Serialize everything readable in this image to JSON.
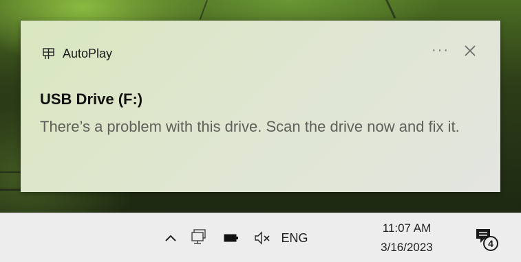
{
  "toast": {
    "app_name": "AutoPlay",
    "more_label": "···",
    "title": "USB Drive (F:)",
    "body": "There’s a problem with this drive.  Scan the drive now and fix it."
  },
  "taskbar": {
    "language": "ENG",
    "time": "11:07 AM",
    "date": "3/16/2023",
    "notification_count": "4"
  },
  "icons": {
    "app": "autoplay-icon",
    "close": "close-icon",
    "chevron": "chevron-up-icon",
    "network": "network-icon",
    "battery": "battery-icon",
    "volume": "volume-muted-icon",
    "action_center": "action-center-icon"
  }
}
